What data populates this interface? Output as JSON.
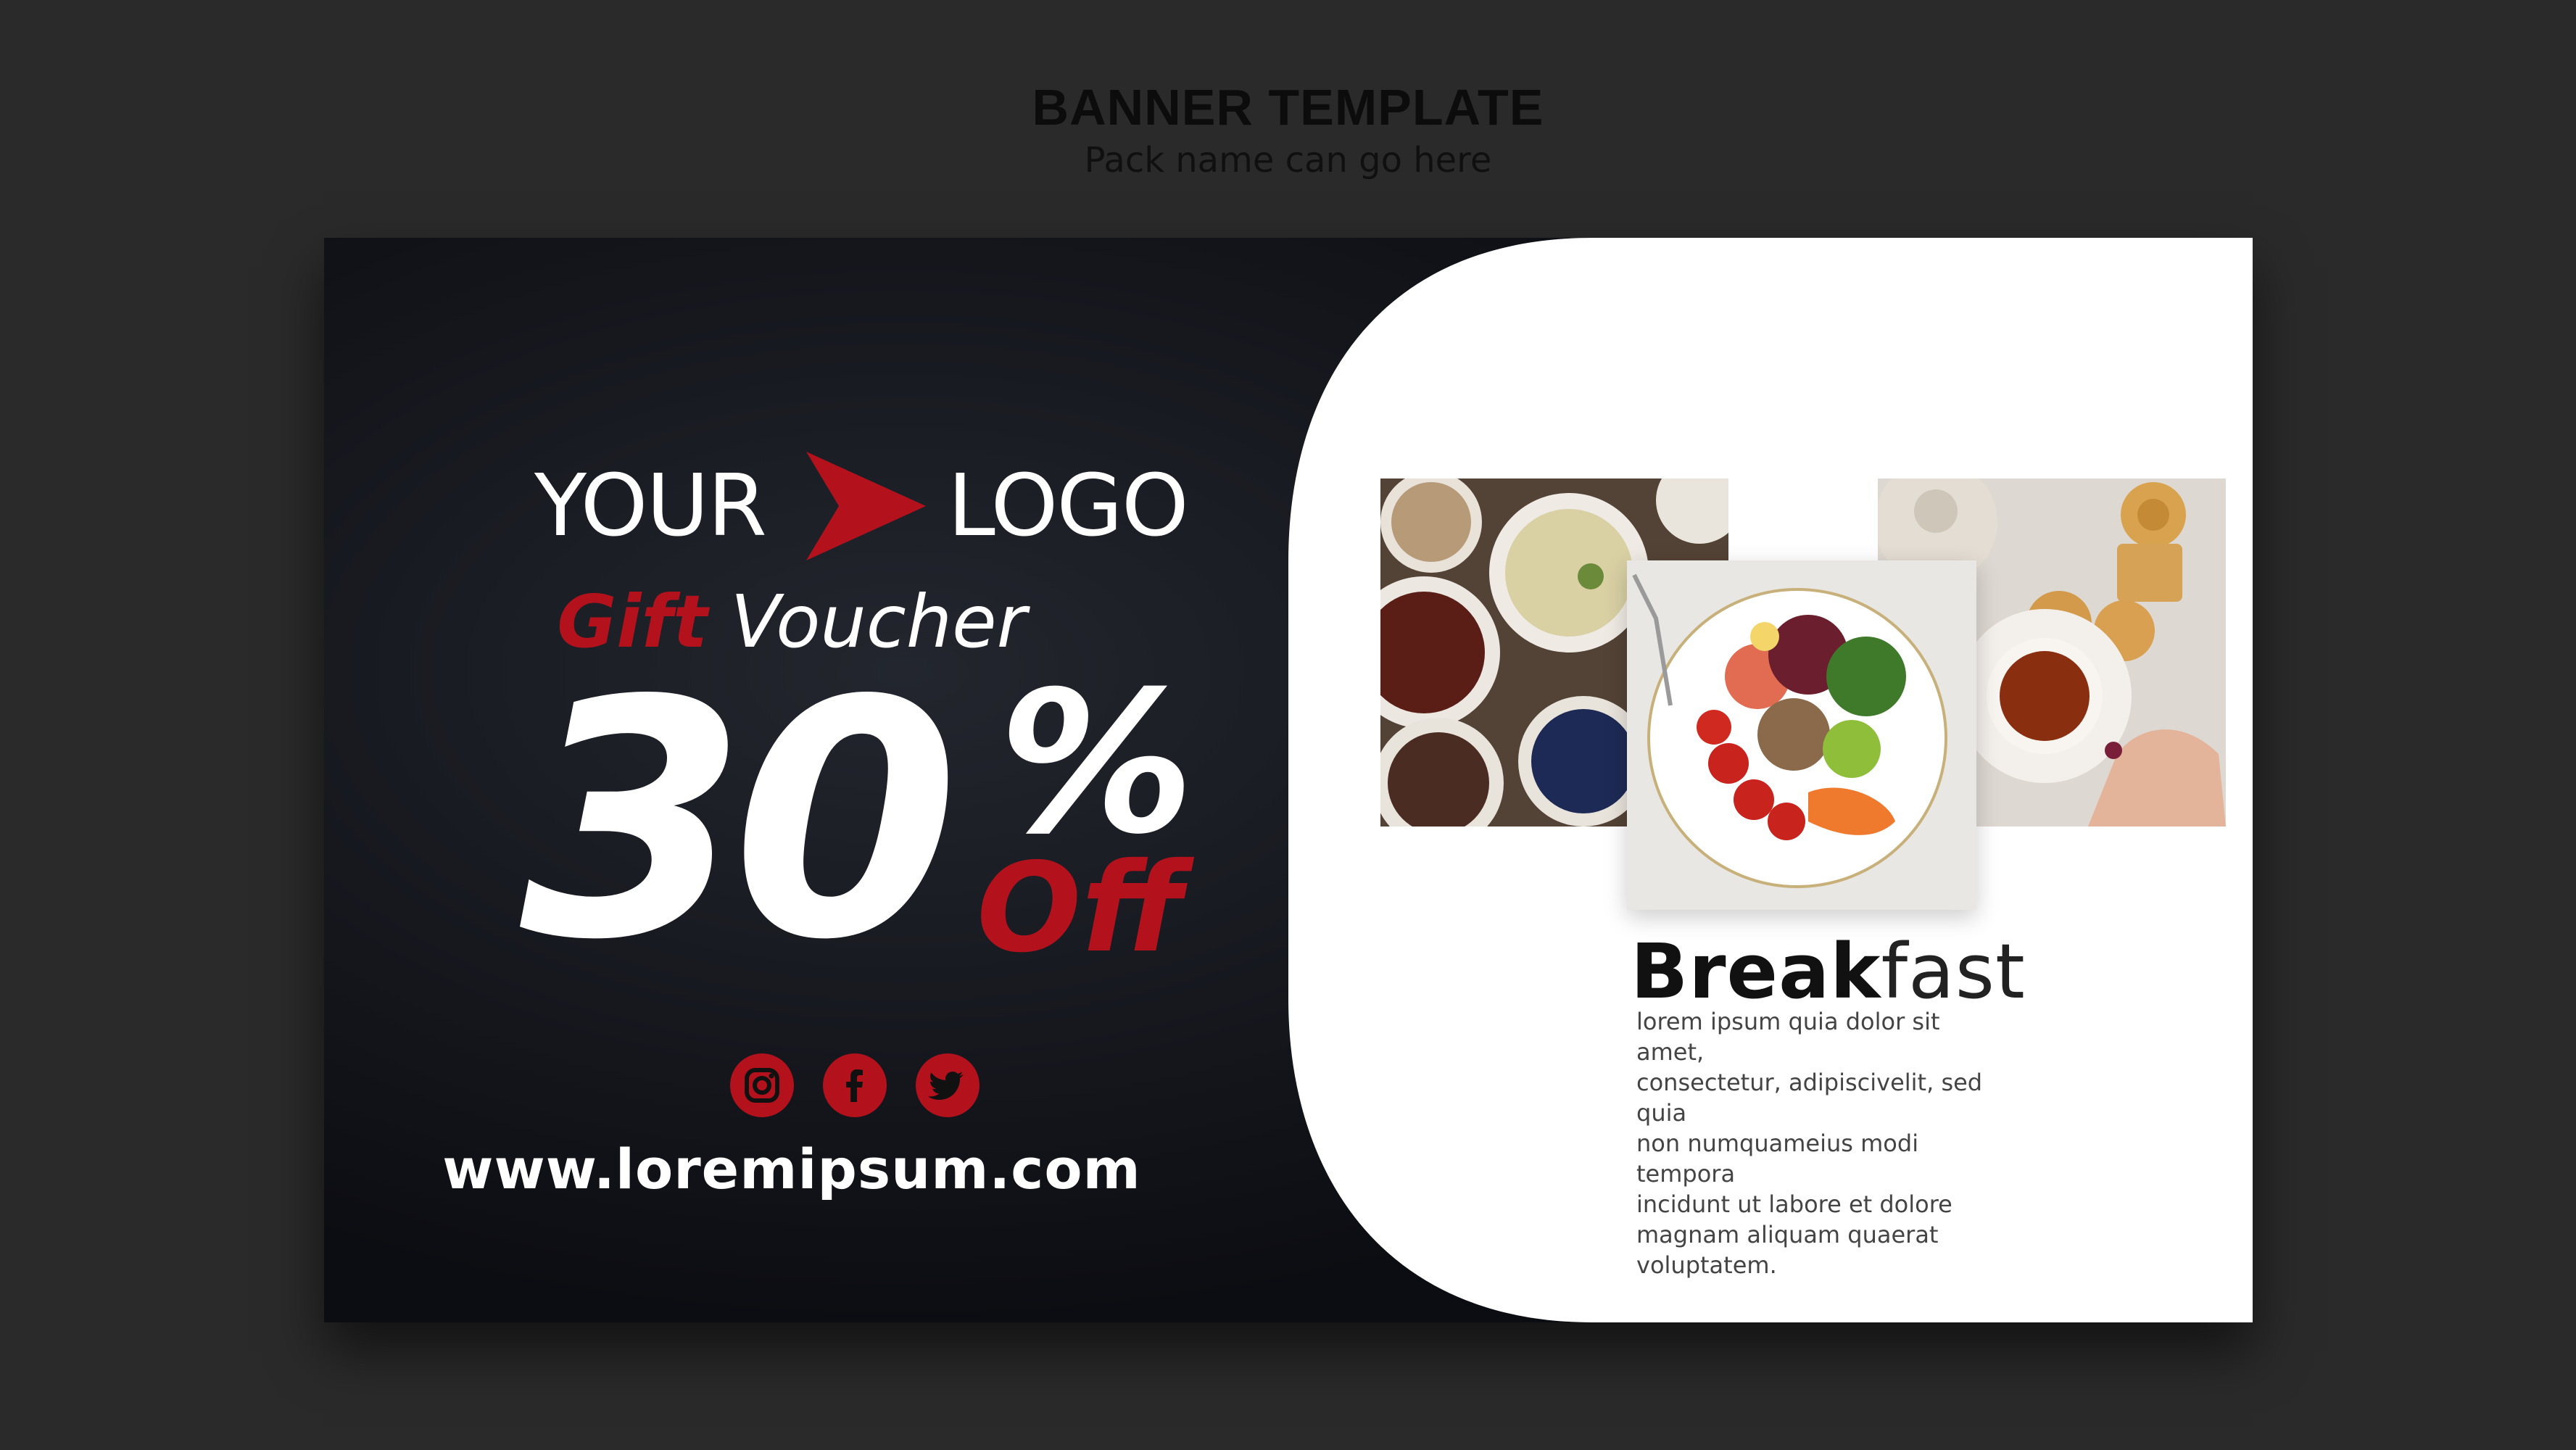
{
  "header": {
    "title": "BANNER TEMPLATE",
    "subtitle": "Pack name can go here"
  },
  "banner": {
    "logo": {
      "left_word": "YOUR",
      "right_word": "LOGO"
    },
    "voucher": {
      "word_accent": "Gift",
      "word_plain": "Voucher"
    },
    "discount": {
      "number": "30",
      "percent": "%",
      "off": "Off"
    },
    "socials": [
      {
        "name": "instagram-icon"
      },
      {
        "name": "facebook-icon"
      },
      {
        "name": "twitter-icon"
      }
    ],
    "website": "www.loremipsum.com",
    "caption": {
      "title_bold": "Break",
      "title_thin": "fast",
      "body": "lorem ipsum quia dolor sit amet,\nconsectetur, adipiscivelit, sed quia\nnon numquameius modi tempora\nincidunt ut  labore et dolore\nmagnam aliquam quaerat\nvoluptatem."
    },
    "colors": {
      "accent": "#b3121d",
      "dark": "#111319",
      "panel": "#ffffff"
    }
  }
}
